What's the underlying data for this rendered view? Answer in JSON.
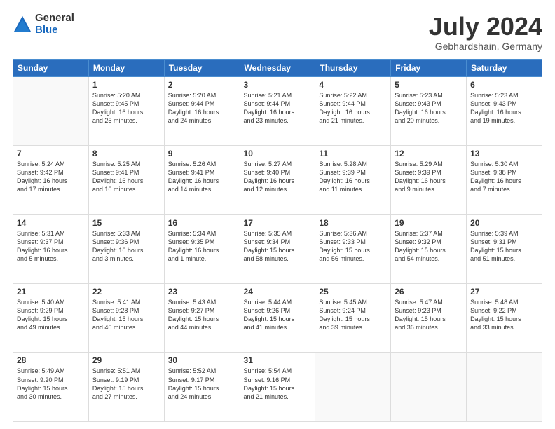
{
  "logo": {
    "general": "General",
    "blue": "Blue"
  },
  "title": "July 2024",
  "subtitle": "Gebhardshain, Germany",
  "days": [
    "Sunday",
    "Monday",
    "Tuesday",
    "Wednesday",
    "Thursday",
    "Friday",
    "Saturday"
  ],
  "weeks": [
    [
      {
        "day": "",
        "info": ""
      },
      {
        "day": "1",
        "info": "Sunrise: 5:20 AM\nSunset: 9:45 PM\nDaylight: 16 hours\nand 25 minutes."
      },
      {
        "day": "2",
        "info": "Sunrise: 5:20 AM\nSunset: 9:44 PM\nDaylight: 16 hours\nand 24 minutes."
      },
      {
        "day": "3",
        "info": "Sunrise: 5:21 AM\nSunset: 9:44 PM\nDaylight: 16 hours\nand 23 minutes."
      },
      {
        "day": "4",
        "info": "Sunrise: 5:22 AM\nSunset: 9:44 PM\nDaylight: 16 hours\nand 21 minutes."
      },
      {
        "day": "5",
        "info": "Sunrise: 5:23 AM\nSunset: 9:43 PM\nDaylight: 16 hours\nand 20 minutes."
      },
      {
        "day": "6",
        "info": "Sunrise: 5:23 AM\nSunset: 9:43 PM\nDaylight: 16 hours\nand 19 minutes."
      }
    ],
    [
      {
        "day": "7",
        "info": "Sunrise: 5:24 AM\nSunset: 9:42 PM\nDaylight: 16 hours\nand 17 minutes."
      },
      {
        "day": "8",
        "info": "Sunrise: 5:25 AM\nSunset: 9:41 PM\nDaylight: 16 hours\nand 16 minutes."
      },
      {
        "day": "9",
        "info": "Sunrise: 5:26 AM\nSunset: 9:41 PM\nDaylight: 16 hours\nand 14 minutes."
      },
      {
        "day": "10",
        "info": "Sunrise: 5:27 AM\nSunset: 9:40 PM\nDaylight: 16 hours\nand 12 minutes."
      },
      {
        "day": "11",
        "info": "Sunrise: 5:28 AM\nSunset: 9:39 PM\nDaylight: 16 hours\nand 11 minutes."
      },
      {
        "day": "12",
        "info": "Sunrise: 5:29 AM\nSunset: 9:39 PM\nDaylight: 16 hours\nand 9 minutes."
      },
      {
        "day": "13",
        "info": "Sunrise: 5:30 AM\nSunset: 9:38 PM\nDaylight: 16 hours\nand 7 minutes."
      }
    ],
    [
      {
        "day": "14",
        "info": "Sunrise: 5:31 AM\nSunset: 9:37 PM\nDaylight: 16 hours\nand 5 minutes."
      },
      {
        "day": "15",
        "info": "Sunrise: 5:33 AM\nSunset: 9:36 PM\nDaylight: 16 hours\nand 3 minutes."
      },
      {
        "day": "16",
        "info": "Sunrise: 5:34 AM\nSunset: 9:35 PM\nDaylight: 16 hours\nand 1 minute."
      },
      {
        "day": "17",
        "info": "Sunrise: 5:35 AM\nSunset: 9:34 PM\nDaylight: 15 hours\nand 58 minutes."
      },
      {
        "day": "18",
        "info": "Sunrise: 5:36 AM\nSunset: 9:33 PM\nDaylight: 15 hours\nand 56 minutes."
      },
      {
        "day": "19",
        "info": "Sunrise: 5:37 AM\nSunset: 9:32 PM\nDaylight: 15 hours\nand 54 minutes."
      },
      {
        "day": "20",
        "info": "Sunrise: 5:39 AM\nSunset: 9:31 PM\nDaylight: 15 hours\nand 51 minutes."
      }
    ],
    [
      {
        "day": "21",
        "info": "Sunrise: 5:40 AM\nSunset: 9:29 PM\nDaylight: 15 hours\nand 49 minutes."
      },
      {
        "day": "22",
        "info": "Sunrise: 5:41 AM\nSunset: 9:28 PM\nDaylight: 15 hours\nand 46 minutes."
      },
      {
        "day": "23",
        "info": "Sunrise: 5:43 AM\nSunset: 9:27 PM\nDaylight: 15 hours\nand 44 minutes."
      },
      {
        "day": "24",
        "info": "Sunrise: 5:44 AM\nSunset: 9:26 PM\nDaylight: 15 hours\nand 41 minutes."
      },
      {
        "day": "25",
        "info": "Sunrise: 5:45 AM\nSunset: 9:24 PM\nDaylight: 15 hours\nand 39 minutes."
      },
      {
        "day": "26",
        "info": "Sunrise: 5:47 AM\nSunset: 9:23 PM\nDaylight: 15 hours\nand 36 minutes."
      },
      {
        "day": "27",
        "info": "Sunrise: 5:48 AM\nSunset: 9:22 PM\nDaylight: 15 hours\nand 33 minutes."
      }
    ],
    [
      {
        "day": "28",
        "info": "Sunrise: 5:49 AM\nSunset: 9:20 PM\nDaylight: 15 hours\nand 30 minutes."
      },
      {
        "day": "29",
        "info": "Sunrise: 5:51 AM\nSunset: 9:19 PM\nDaylight: 15 hours\nand 27 minutes."
      },
      {
        "day": "30",
        "info": "Sunrise: 5:52 AM\nSunset: 9:17 PM\nDaylight: 15 hours\nand 24 minutes."
      },
      {
        "day": "31",
        "info": "Sunrise: 5:54 AM\nSunset: 9:16 PM\nDaylight: 15 hours\nand 21 minutes."
      },
      {
        "day": "",
        "info": ""
      },
      {
        "day": "",
        "info": ""
      },
      {
        "day": "",
        "info": ""
      }
    ]
  ]
}
